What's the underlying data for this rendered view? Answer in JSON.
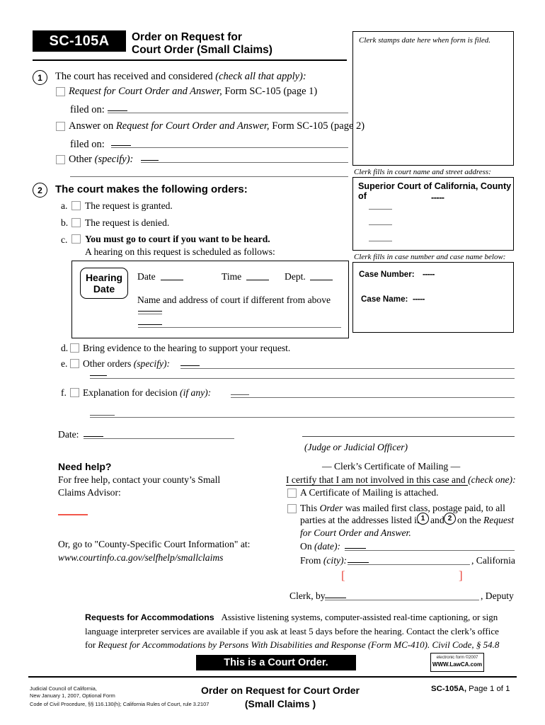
{
  "header": {
    "form_code": "SC-105A",
    "title_line1": "Order on Request for",
    "title_line2": "Court Order (Small Claims)"
  },
  "clerk_boxes": {
    "stamp_caption": "Clerk stamps date here when form is filed.",
    "court_caption": "Clerk fills in court name and street address:",
    "court_title": "Superior Court of California, County of",
    "case_caption": "Clerk fills in case number and case name below:",
    "case_number_label": "Case Number:",
    "case_number_value": "-----",
    "case_name_label": "Case Name:",
    "case_name_value": "-----",
    "county_value": "-----"
  },
  "section1": {
    "number": "1",
    "heading_plain": "The court has received and considered ",
    "heading_italic": "(check all that apply):",
    "items": [
      {
        "italic_text": "Request for Court Order and Answer,",
        "plain_text": " Form SC-105 (page 1)",
        "sub_label": "filed on:"
      },
      {
        "lead_text": "Answer on ",
        "italic_text": "Request for Court Order and Answer,",
        "plain_text": " Form SC-105 (page 2)",
        "sub_label": "filed on: "
      },
      {
        "lead_text": "Other ",
        "italic_text": "(specify):",
        "plain_text": ""
      }
    ]
  },
  "section2": {
    "number": "2",
    "heading": "The court makes the following orders:",
    "items": [
      {
        "letter": "a.",
        "text": "The request is granted."
      },
      {
        "letter": "b.",
        "text": "The request is denied."
      },
      {
        "letter": "c.",
        "text": "You must go to court if you want to be heard.",
        "sub_text": "A hearing on this request is scheduled as follows:"
      },
      {
        "letter": "d.",
        "text": "Bring evidence to the hearing to support your request."
      },
      {
        "letter": "e.",
        "text": "Other orders ",
        "italic_text": "(specify):"
      },
      {
        "letter": "f.",
        "text": "Explanation for decision ",
        "italic_text": "(if any):"
      }
    ]
  },
  "hearing_box": {
    "pill_line1": "Hearing",
    "pill_line2": "Date",
    "date_label": "Date",
    "time_label": "Time",
    "dept_label": "Dept.",
    "address_label": "Name and address of court if different from above"
  },
  "signature": {
    "date_label": "Date:",
    "judge_label": "(Judge or Judicial Officer)"
  },
  "need_help": {
    "heading": "Need help?",
    "line1": "For free help, contact your county’s Small",
    "line2": "Claims Advisor:",
    "line3": "Or, go to \"County-Specific Court Information\" at:",
    "url": "www.courtinfo.ca.gov/selfhelp/smallclaims"
  },
  "certificate": {
    "title": "— Clerk’s Certificate of Mailing —",
    "intro_plain": "I certify that I am not involved in this case and ",
    "intro_italic": "(check one):",
    "option1": "A Certificate of Mailing is attached.",
    "option2_a": "This ",
    "option2_order": "Order",
    "option2_b": " was mailed first class, postage paid, to all",
    "option2_c1": "parties at the addresses listed in",
    "option2_num1": "1",
    "option2_and": "and",
    "option2_num2": "2",
    "option2_c2": "on the ",
    "option2_italic": "Request",
    "option2_c3": "for Court Order and Answer.",
    "on_date_label": "On ",
    "on_date_italic": "(date):",
    "from_city_label": "From ",
    "from_city_italic": "(city):",
    "california": ", California",
    "seal_left": "[",
    "seal_right": "]",
    "clerk_by": "Clerk, by",
    "deputy": ", Deputy"
  },
  "accommodations": {
    "heading": "Requests for Accommodations",
    "body1": "Assistive listening systems, computer-assisted real-time captioning, or sign",
    "body2": "language interpreter services are available if you ask at least 5 days before the hearing. Contact the clerk’s office",
    "body3_plain": "for ",
    "body3_italic": "Request for Accommodations by Persons With Disabilities and Response (Form MC-410). Civil Code, § 54.8"
  },
  "banner": {
    "text": "This is a Court Order."
  },
  "lawca_stamp": {
    "line1": "electronic form ©2007",
    "line2": "WWW.LawCA.com"
  },
  "footer": {
    "left_line1": "Judicial Council of California,",
    "left_line2": "New January 1, 2007, Optional Form",
    "left_line3": "Code of Civil Procedure, §§ 116.130(h); California Rules of Court, rule 3.2107",
    "center_line1": "Order on Request for Court Order",
    "center_line2": "(Small Claims )",
    "right_code": "SC-105A,",
    "right_page": " Page 1 of 1"
  }
}
